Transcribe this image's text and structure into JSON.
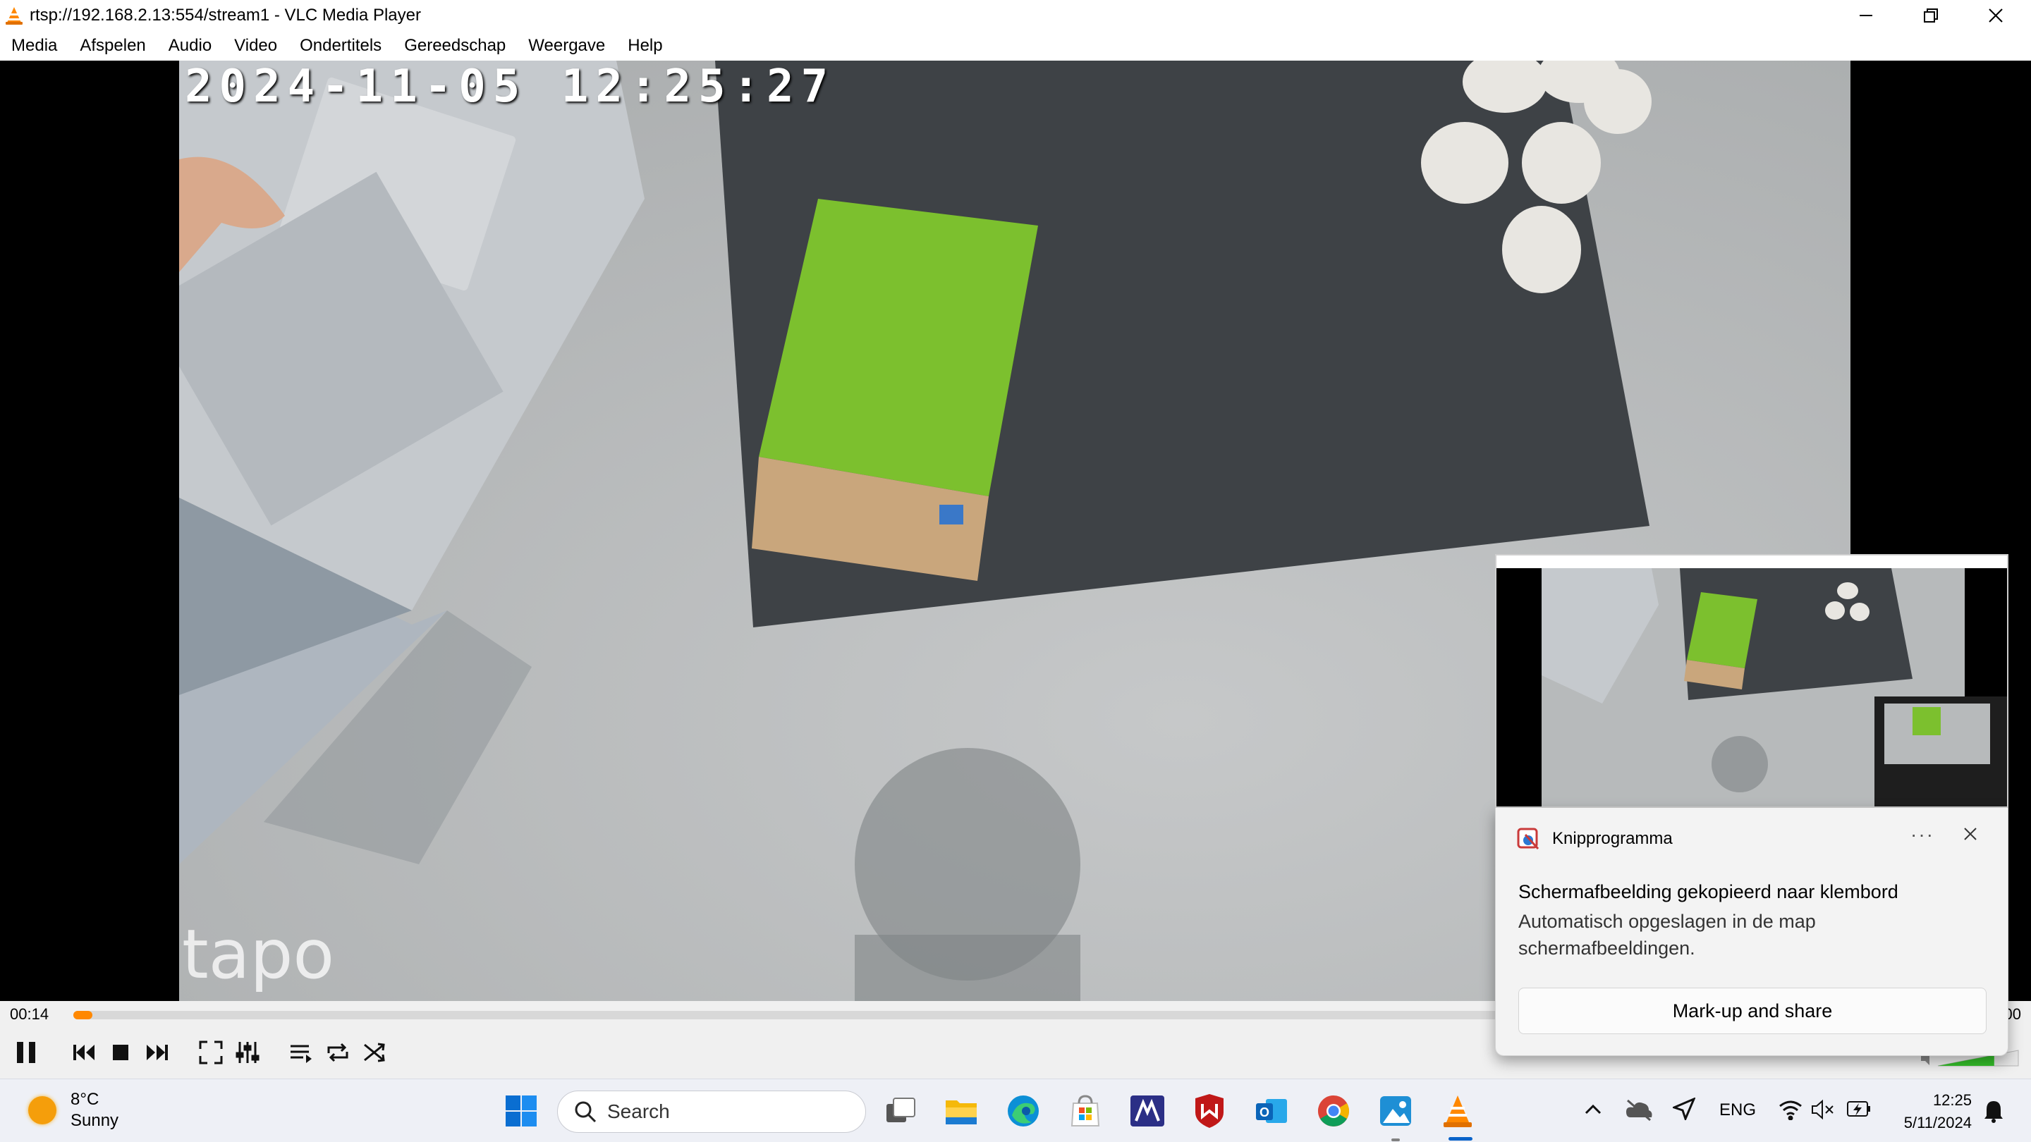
{
  "window": {
    "title": "rtsp://192.168.2.13:554/stream1 - VLC Media Player",
    "brand_color": "#ff8800"
  },
  "menu": [
    "Media",
    "Afspelen",
    "Audio",
    "Video",
    "Ondertitels",
    "Gereedschap",
    "Weergave",
    "Help"
  ],
  "video": {
    "timestamp": "2024-11-05 12:25:27",
    "watermark": "tapo"
  },
  "controls": {
    "elapsed": "00:14",
    "total": "00:00",
    "progress_fraction": 0.01,
    "volume_fraction": 0.7,
    "buttons": [
      "pause-icon",
      "previous-icon",
      "stop-icon",
      "next-icon",
      "fullscreen-icon",
      "extended-settings-icon",
      "playlist-icon",
      "loop-icon",
      "shuffle-icon"
    ]
  },
  "taskbar": {
    "weather_temp": "8°C",
    "weather_desc": "Sunny",
    "search_label": "Search",
    "language": "ENG",
    "time": "12:25",
    "date": "5/11/2024",
    "apps": [
      "start-icon",
      "task-view-icon",
      "file-explorer-icon",
      "edge-icon",
      "microsoft-store-icon",
      "app-m-icon",
      "mcafee-icon",
      "outlook-icon",
      "chrome-icon",
      "photos-icon",
      "vlc-icon"
    ]
  },
  "toast": {
    "app_name": "Knipprogramma",
    "heading": "Schermafbeelding gekopieerd naar klembord",
    "body": "Automatisch opgeslagen in de map schermafbeeldingen.",
    "action_label": "Mark-up and share",
    "more": "···"
  }
}
